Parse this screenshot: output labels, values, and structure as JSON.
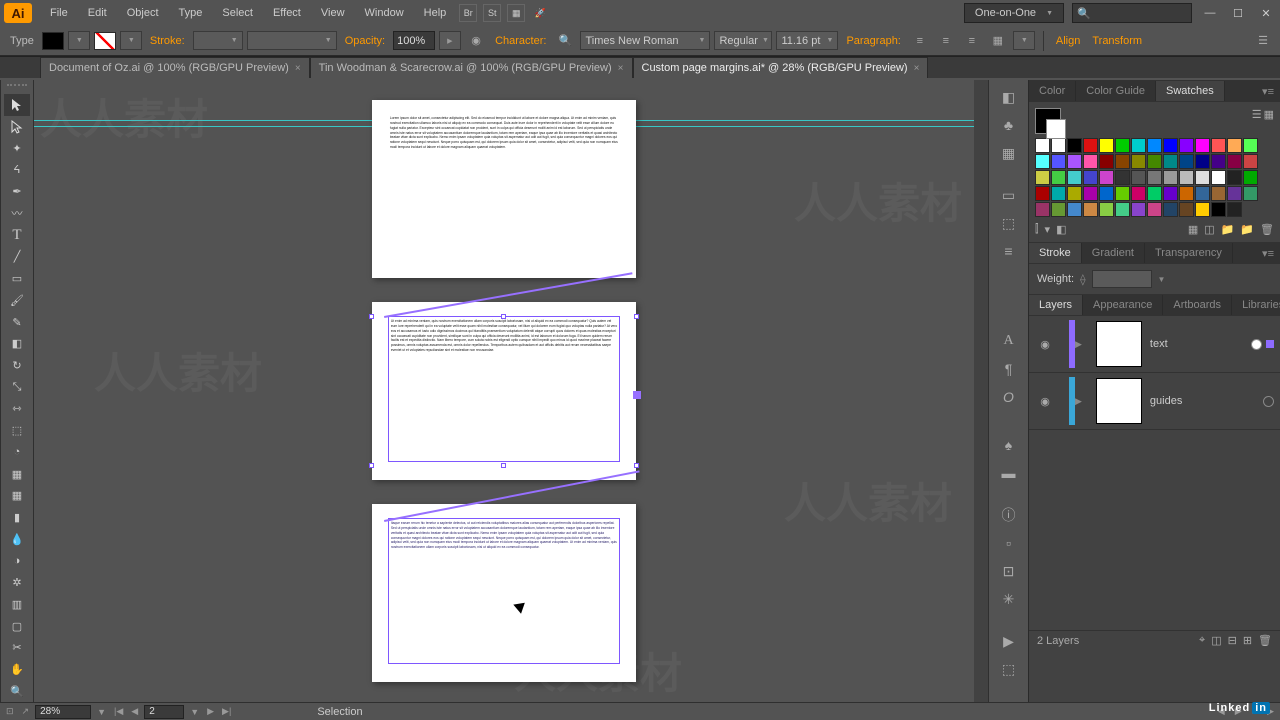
{
  "app": {
    "logo": "Ai"
  },
  "menu": {
    "items": [
      "File",
      "Edit",
      "Object",
      "Type",
      "Select",
      "Effect",
      "View",
      "Window",
      "Help"
    ]
  },
  "workspace": {
    "name": "One-on-One"
  },
  "search": {
    "glyph": "🔍"
  },
  "control": {
    "typeLabel": "Type",
    "strokeLabel": "Stroke:",
    "opacityLabel": "Opacity:",
    "opacityValue": "100%",
    "characterLabel": "Character:",
    "font": "Times New Roman",
    "fontStyle": "Regular",
    "fontSize": "11.16 pt",
    "paragraphLabel": "Paragraph:",
    "alignLabel": "Align",
    "transformLabel": "Transform"
  },
  "tabs": [
    {
      "title": "Document of Oz.ai @ 100% (RGB/GPU Preview)"
    },
    {
      "title": "Tin Woodman & Scarecrow.ai @ 100% (RGB/GPU Preview)"
    },
    {
      "title": "Custom page margins.ai* @ 28% (RGB/GPU Preview)",
      "active": true
    }
  ],
  "status": {
    "zoom": "28%",
    "artboardNav": "2",
    "tool": "Selection"
  },
  "panels": {
    "colorTabs": [
      "Color",
      "Color Guide",
      "Swatches"
    ],
    "strokeTabs": [
      "Stroke",
      "Gradient",
      "Transparency"
    ],
    "weightLabel": "Weight:",
    "layerTabs": [
      "Layers",
      "Appearance",
      "Artboards",
      "Libraries"
    ],
    "layers": [
      {
        "name": "text",
        "selected": true,
        "color": "#8e6bff"
      },
      {
        "name": "guides",
        "selected": false,
        "color": "#3aa7d8"
      }
    ],
    "layerCount": "2 Layers"
  },
  "swatchColors": [
    "#ffffff",
    "#ffffff",
    "#000000",
    "#d11",
    "#ff0",
    "#0c0",
    "#0cc",
    "#08f",
    "#00f",
    "#80f",
    "#f0f",
    "#f55",
    "#fa5",
    "#5f5",
    "#5ff",
    "#55f",
    "#a5f",
    "#f5a",
    "#800",
    "#840",
    "#880",
    "#480",
    "#088",
    "#048",
    "#008",
    "#408",
    "#804",
    "#c44",
    "#cc4",
    "#4c4",
    "#4cc",
    "#44c",
    "#c4c",
    "#333",
    "#555",
    "#777",
    "#999",
    "#bbb",
    "#ddd",
    "#fff",
    "#222",
    "#0a0",
    "#a00",
    "#0aa",
    "#aa0",
    "#a0a",
    "#06c",
    "#6c0",
    "#c06",
    "#0c6",
    "#60c",
    "#c60",
    "#369",
    "#963",
    "#639",
    "#396",
    "#936",
    "#693",
    "#48c",
    "#c84",
    "#8c4",
    "#4c8",
    "#84c",
    "#c48",
    "#246",
    "#642",
    "#fc0",
    "#000",
    "#222"
  ],
  "watermark_cn": "人人素材",
  "linkedin": {
    "text": "Linked",
    "in": "in"
  }
}
